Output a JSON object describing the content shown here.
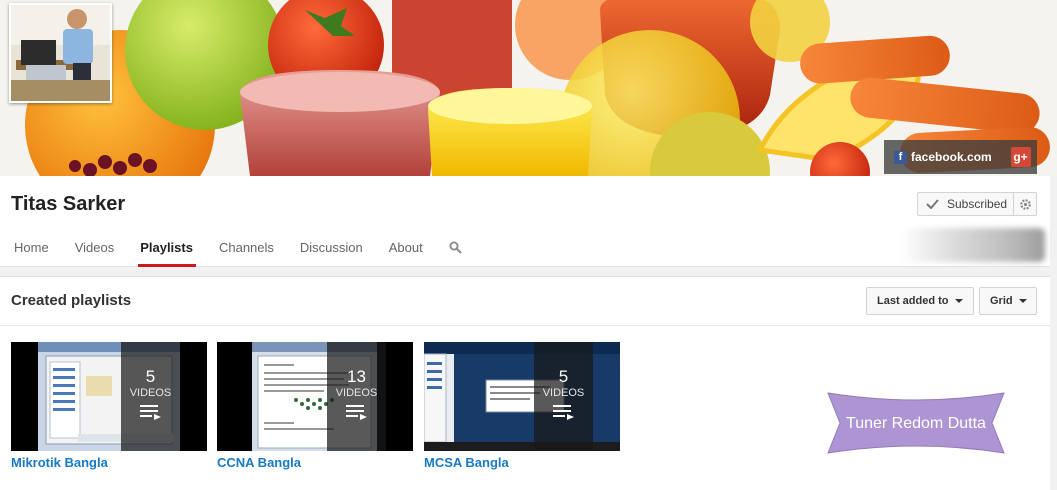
{
  "banner": {
    "facebook_label": "facebook.com",
    "facebook_icon": "facebook-icon",
    "googleplus_icon": "google-plus-icon",
    "googleplus_glyph": "g+"
  },
  "channel": {
    "name": "Titas Sarker",
    "subscribe_label": "Subscribed",
    "tabs": [
      "Home",
      "Videos",
      "Playlists",
      "Channels",
      "Discussion",
      "About"
    ],
    "active_tab": "Playlists"
  },
  "section": {
    "title": "Created playlists",
    "sort_label": "Last added to",
    "view_label": "Grid"
  },
  "playlists": [
    {
      "title": "Mikrotik Bangla",
      "count": "5",
      "count_label": "VIDEOS"
    },
    {
      "title": "CCNA Bangla",
      "count": "13",
      "count_label": "VIDEOS"
    },
    {
      "title": "MCSA Bangla",
      "count": "5",
      "count_label": "VIDEOS"
    }
  ],
  "watermark": {
    "text": "Tuner Redom Dutta"
  },
  "colors": {
    "accent": "#cc181e",
    "link": "#167ac6",
    "watermark": "#a98fd1"
  }
}
